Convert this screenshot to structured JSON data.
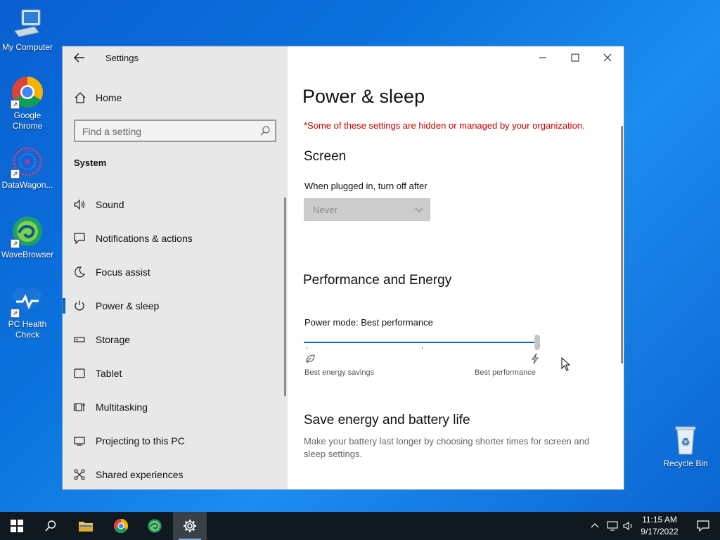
{
  "desktop": {
    "icons": [
      {
        "label": "My Computer"
      },
      {
        "label": "Google Chrome"
      },
      {
        "label": "DataWagon..."
      },
      {
        "label": "WaveBrowser"
      },
      {
        "label": "PC Health Check"
      },
      {
        "label": "Recycle Bin"
      }
    ]
  },
  "window": {
    "app_title": "Settings",
    "sidebar": {
      "home_label": "Home",
      "search_placeholder": "Find a setting",
      "section": "System",
      "items": [
        {
          "label": "Sound",
          "icon": "speaker-icon"
        },
        {
          "label": "Notifications & actions",
          "icon": "message-icon"
        },
        {
          "label": "Focus assist",
          "icon": "moon-icon"
        },
        {
          "label": "Power & sleep",
          "icon": "power-icon",
          "active": true
        },
        {
          "label": "Storage",
          "icon": "storage-icon"
        },
        {
          "label": "Tablet",
          "icon": "tablet-icon"
        },
        {
          "label": "Multitasking",
          "icon": "multitasking-icon"
        },
        {
          "label": "Projecting to this PC",
          "icon": "projector-icon"
        },
        {
          "label": "Shared experiences",
          "icon": "shared-icon"
        }
      ]
    },
    "content": {
      "page_title": "Power & sleep",
      "managed_warning": "*Some of these settings are hidden or managed by your organization.",
      "screen_heading": "Screen",
      "plugged_in_label": "When plugged in, turn off after",
      "plugged_in_value": "Never",
      "perf_heading": "Performance and Energy",
      "power_mode_label": "Power mode: Best performance",
      "power_mode_level": 1.0,
      "slider_left_label": "Best energy savings",
      "slider_right_label": "Best performance",
      "save_heading": "Save energy and battery life",
      "save_text": "Make your battery last longer by choosing shorter times for screen and sleep settings."
    }
  },
  "taskbar": {
    "time": "11:15 AM",
    "date": "9/17/2022"
  },
  "colors": {
    "accent": "#0067c0",
    "warning": "#c50000"
  }
}
